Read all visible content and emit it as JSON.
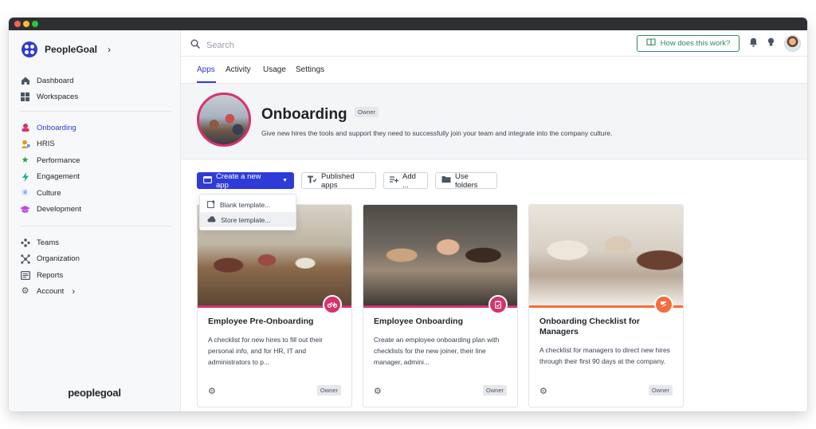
{
  "sidebar": {
    "org_name": "PeopleGoal",
    "top_items": [
      {
        "label": "Dashboard",
        "icon": "home-icon"
      },
      {
        "label": "Workspaces",
        "icon": "grid-icon"
      }
    ],
    "app_items": [
      {
        "label": "Onboarding",
        "icon": "onboarding-icon",
        "color": "#d6336c",
        "active": true
      },
      {
        "label": "HRIS",
        "icon": "user-icon",
        "color": "#e09a1a"
      },
      {
        "label": "Performance",
        "icon": "star-icon",
        "color": "#2f9e44"
      },
      {
        "label": "Engagement",
        "icon": "bolt-icon",
        "color": "#12b886"
      },
      {
        "label": "Culture",
        "icon": "snowflake-icon",
        "color": "#4c8df6"
      },
      {
        "label": "Development",
        "icon": "graduation-icon",
        "color": "#be4bdb"
      }
    ],
    "bottom_items": [
      {
        "label": "Teams",
        "icon": "teams-icon"
      },
      {
        "label": "Organization",
        "icon": "organization-icon"
      },
      {
        "label": "Reports",
        "icon": "reports-icon"
      },
      {
        "label": "Account",
        "icon": "gear-icon"
      }
    ],
    "footer_logo": "peoplegoal"
  },
  "topbar": {
    "search_placeholder": "Search",
    "help_label": "How does this work?"
  },
  "tabs": [
    "Apps",
    "Activity",
    "Usage",
    "Settings"
  ],
  "hero": {
    "title": "Onboarding",
    "badge": "Owner",
    "description": "Give new hires the tools and support they need to successfully join your team and integrate into the company culture."
  },
  "toolbar": {
    "create_label": "Create a new app",
    "published_label": "Published apps",
    "add_label": "Add ...",
    "folders_label": "Use folders"
  },
  "dropdown": {
    "items": [
      "Blank template...",
      "Store template..."
    ]
  },
  "cards": [
    {
      "title": "Employee Pre-Onboarding",
      "description": "A checklist for new hires to fill out their personal info, and for HR, IT and administrators to p...",
      "badge": "Owner",
      "accent": "#d6336c",
      "icon": "bike-icon"
    },
    {
      "title": "Employee Onboarding",
      "description": "Create an employee onboarding plan with checklists for the new joiner, their line manager, admini...",
      "badge": "Owner",
      "accent": "#d6336c",
      "icon": "clipboard-icon"
    },
    {
      "title": "Onboarding Checklist for Managers",
      "description": "A checklist for managers to direct new hires through their first 90 days at the company.",
      "badge": "Owner",
      "accent": "#f76b3c",
      "icon": "manager-icon"
    }
  ],
  "colors": {
    "primary": "#2f3bd6",
    "help_green": "#2f8a5c",
    "onboarding_pink": "#d6336c"
  }
}
